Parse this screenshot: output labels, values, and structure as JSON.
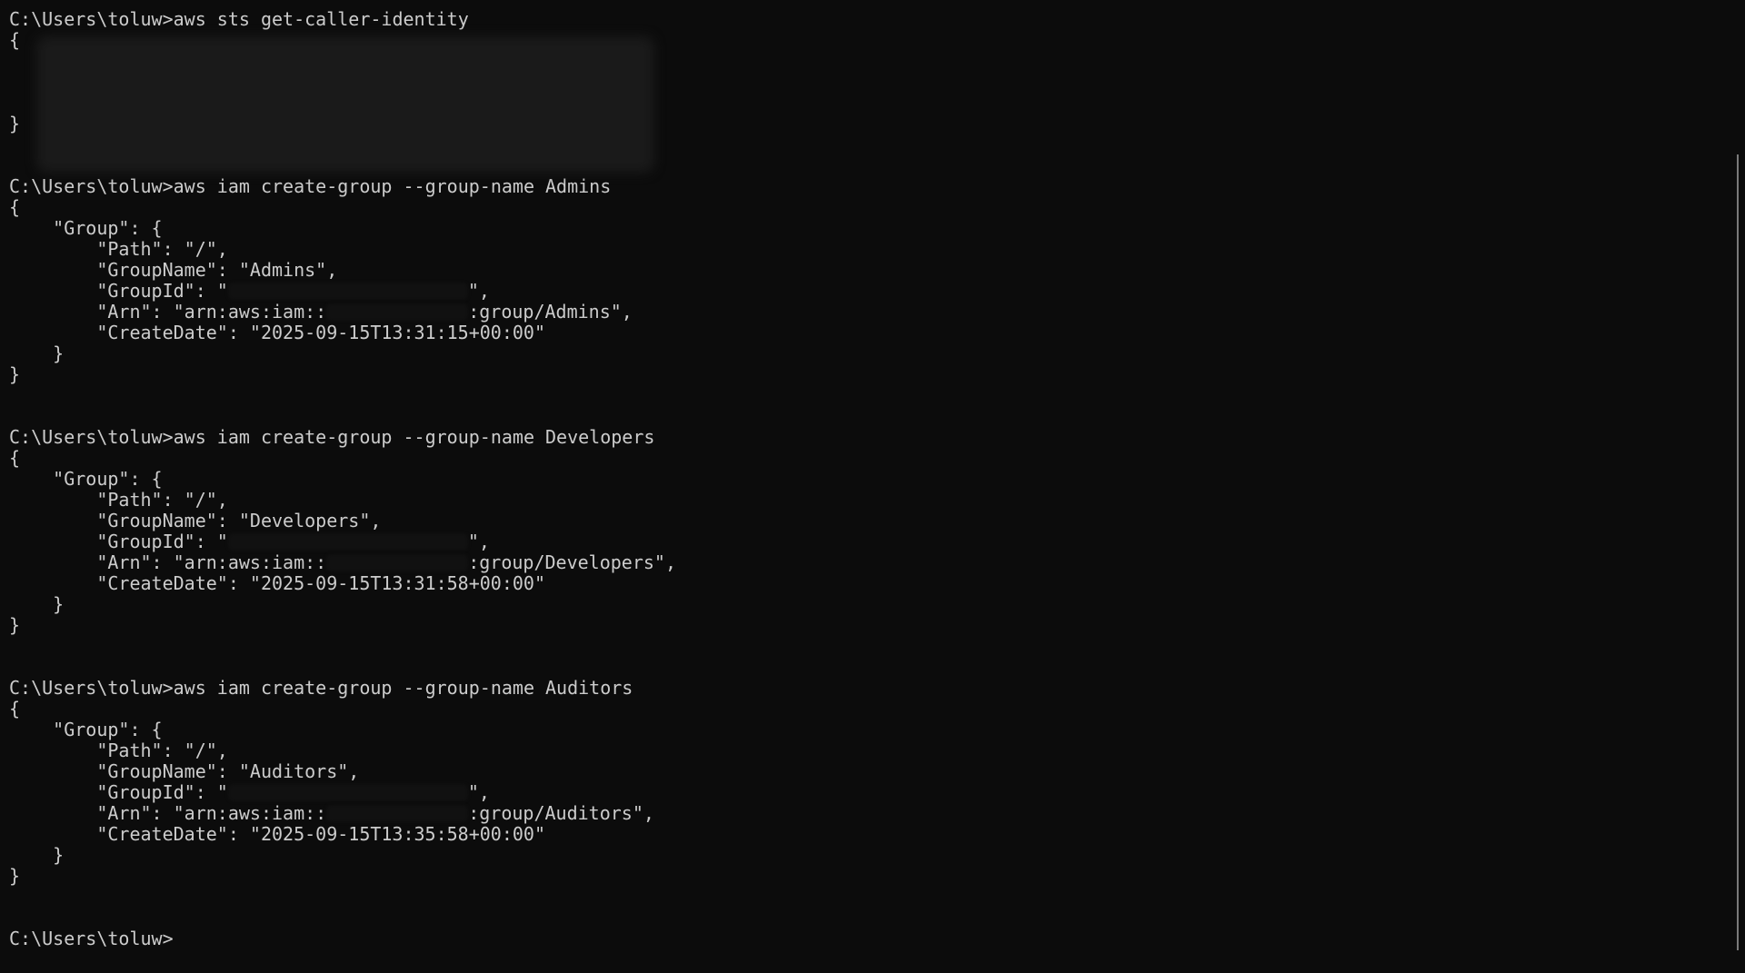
{
  "prompt": "C:\\Users\\toluw>",
  "blocks": [
    {
      "command": "aws sts get-caller-identity",
      "open_brace": "{",
      "close_brace": "}"
    },
    {
      "command": "aws iam create-group --group-name Admins",
      "open_brace": "{",
      "group_open": "    \"Group\": {",
      "path": "        \"Path\": \"/\",",
      "group_name": "        \"GroupName\": \"Admins\",",
      "group_id_prefix": "        \"GroupId\": \"",
      "group_id_suffix": "\",",
      "arn_prefix": "        \"Arn\": \"arn:aws:iam::",
      "arn_suffix": ":group/Admins\",",
      "create_date": "        \"CreateDate\": \"2025-09-15T13:31:15+00:00\"",
      "group_close": "    }",
      "close_brace": "}"
    },
    {
      "command": "aws iam create-group --group-name Developers",
      "open_brace": "{",
      "group_open": "    \"Group\": {",
      "path": "        \"Path\": \"/\",",
      "group_name": "        \"GroupName\": \"Developers\",",
      "group_id_prefix": "        \"GroupId\": \"",
      "group_id_suffix": "\",",
      "arn_prefix": "        \"Arn\": \"arn:aws:iam::",
      "arn_suffix": ":group/Developers\",",
      "create_date": "        \"CreateDate\": \"2025-09-15T13:31:58+00:00\"",
      "group_close": "    }",
      "close_brace": "}"
    },
    {
      "command": "aws iam create-group --group-name Auditors",
      "open_brace": "{",
      "group_open": "    \"Group\": {",
      "path": "        \"Path\": \"/\",",
      "group_name": "        \"GroupName\": \"Auditors\",",
      "group_id_prefix": "        \"GroupId\": \"",
      "group_id_suffix": "\",",
      "arn_prefix": "        \"Arn\": \"arn:aws:iam::",
      "arn_suffix": ":group/Auditors\",",
      "create_date": "        \"CreateDate\": \"2025-09-15T13:35:58+00:00\"",
      "group_close": "    }",
      "close_brace": "}"
    }
  ],
  "colors": {
    "background": "#0c0c0c",
    "text": "#cccccc"
  }
}
